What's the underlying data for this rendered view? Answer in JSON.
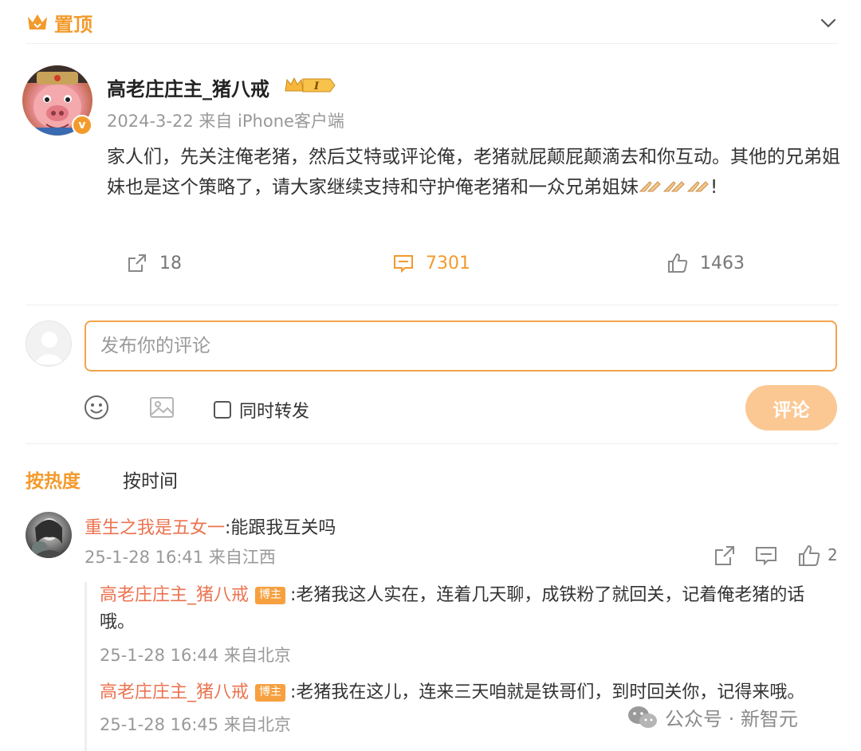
{
  "pin": {
    "label": "置顶",
    "icon": "pin-crown-icon"
  },
  "post": {
    "author": "高老庄庄主_猪八戒",
    "verified_icon": "verified-v-icon",
    "date": "2024-3-22",
    "source": "来自 iPhone客户端",
    "text_1": "家人们，先关注俺老猪，然后艾特或评论俺，老猪就屁颠屁颠滴去和你互动。其他的兄弟姐妹也是这个策略了，请大家继续支持和守护俺老猪和一众兄弟姐妹",
    "text_end": "!",
    "emoji": "praying-hands-emoji",
    "reposts": "18",
    "comments": "7301",
    "likes": "1463"
  },
  "composer": {
    "placeholder": "发布你的评论",
    "repost_label": "同时转发",
    "submit_label": "评论"
  },
  "sort": {
    "hot": "按热度",
    "time": "按时间"
  },
  "comment": {
    "user": "重生之我是五女一",
    "text": ":能跟我互关吗",
    "meta": "25-1-28 16:41 来自江西",
    "likes": "2"
  },
  "replies": [
    {
      "user": "高老庄庄主_猪八戒",
      "tag": "博主",
      "text": ":老猪我这人实在，连着几天聊，成铁粉了就回关，记着俺老猪的话哦。",
      "meta": "25-1-28 16:44 来自北京"
    },
    {
      "user": "高老庄庄主_猪八戒",
      "tag": "博主",
      "text": ":老猪我在这儿，连来三天咱就是铁哥们，到时回关你，记得来哦。",
      "meta": "25-1-28 16:45 来自北京"
    }
  ],
  "watermark": "公众号 · 新智元",
  "colors": {
    "accent": "#f39a2c",
    "username": "#eb7350",
    "submit_disabled": "#fbc893"
  }
}
